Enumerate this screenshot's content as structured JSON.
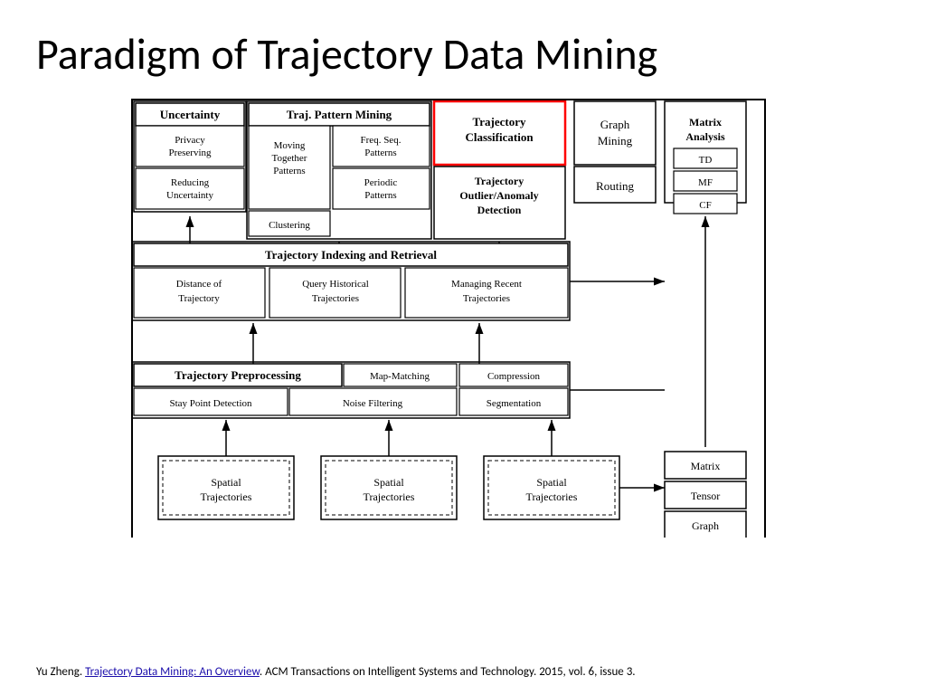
{
  "title": "Paradigm of Trajectory Data Mining",
  "footer": {
    "prefix": "Yu Zheng. ",
    "link_text": "Trajectory Data Mining: An Overview",
    "link_url": "#",
    "suffix": ". ACM Transactions on Intelligent Systems and Technology. 2015, vol. 6, issue 3."
  },
  "diagram": {
    "description": "Paradigm of Trajectory Data Mining diagram"
  }
}
